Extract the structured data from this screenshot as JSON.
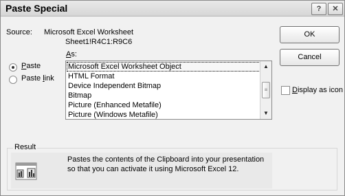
{
  "dialog": {
    "title": "Paste Special",
    "help_glyph": "?",
    "close_glyph": "✕"
  },
  "source": {
    "label": "Source:",
    "line1": "Microsoft Excel Worksheet",
    "line2": "Sheet1!R4C1:R9C6"
  },
  "as_label": "As:",
  "options": {
    "paste": {
      "label": "Paste",
      "selected": true
    },
    "paste_link": {
      "label": "Paste link",
      "selected": false
    }
  },
  "list": {
    "items": [
      "Microsoft Excel Worksheet Object",
      "HTML Format",
      "Device Independent Bitmap",
      "Bitmap",
      "Picture (Enhanced Metafile)",
      "Picture (Windows Metafile)"
    ],
    "selected_index": 0,
    "scroll_up": "▲",
    "scroll_down": "▼",
    "thumb_grip": "≡"
  },
  "buttons": {
    "ok": "OK",
    "cancel": "Cancel"
  },
  "display_as_icon": {
    "label": "Display as icon",
    "checked": false
  },
  "result": {
    "label": "Result",
    "text": "Pastes the contents of the Clipboard into your presentation so that you can activate it using Microsoft Excel 12."
  }
}
